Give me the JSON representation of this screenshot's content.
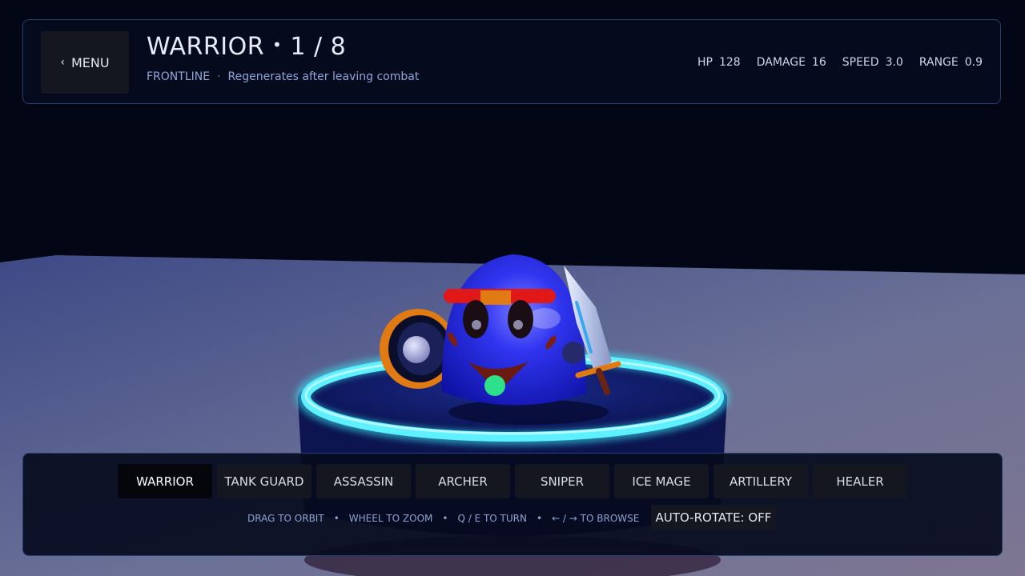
{
  "header": {
    "menu_label": "MENU",
    "unit_name": "WARRIOR",
    "separator": "•",
    "position": "1 / 8",
    "role": "FRONTLINE",
    "sub_separator": "·",
    "passive": "Regenerates after leaving combat"
  },
  "stats": [
    {
      "label": "HP",
      "value": "128"
    },
    {
      "label": "DAMAGE",
      "value": "16"
    },
    {
      "label": "SPEED",
      "value": "3.0"
    },
    {
      "label": "RANGE",
      "value": "0.9"
    }
  ],
  "tabs": [
    {
      "label": "WARRIOR",
      "active": true
    },
    {
      "label": "TANK GUARD",
      "active": false
    },
    {
      "label": "ASSASSIN",
      "active": false
    },
    {
      "label": "ARCHER",
      "active": false
    },
    {
      "label": "SNIPER",
      "active": false
    },
    {
      "label": "ICE MAGE",
      "active": false
    },
    {
      "label": "ARTILLERY",
      "active": false
    },
    {
      "label": "HEALER",
      "active": false
    }
  ],
  "controls_help": [
    "DRAG TO ORBIT",
    "WHEEL TO ZOOM",
    "Q / E TO TURN",
    "← / → TO BROWSE"
  ],
  "help_separator": "•",
  "auto_rotate_label": "AUTO-ROTATE: OFF",
  "icons": {
    "menu_back": "chevron-left-icon"
  },
  "colors": {
    "character_body": "#2a2ee8",
    "headband": "#e01818",
    "ring_glow": "#39e6f6",
    "pedestal": "#0e1a6a",
    "shield_rim": "#e07a12",
    "gem": "#2ee08a"
  }
}
